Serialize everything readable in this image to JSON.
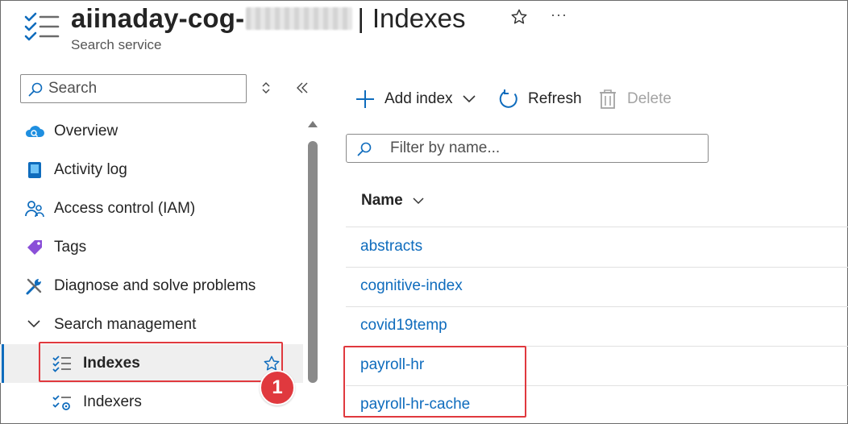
{
  "header": {
    "service_name": "aiinaday-cog-",
    "separator": "|",
    "page_title": "Indexes",
    "subtitle": "Search service",
    "more_label": "···"
  },
  "sidebar": {
    "search_placeholder": "Search",
    "items": [
      {
        "label": "Overview",
        "icon": "cloud-search-icon"
      },
      {
        "label": "Activity log",
        "icon": "activity-log-icon"
      },
      {
        "label": "Access control (IAM)",
        "icon": "people-icon"
      },
      {
        "label": "Tags",
        "icon": "tag-icon"
      },
      {
        "label": "Diagnose and solve problems",
        "icon": "wrench-icon"
      },
      {
        "label": "Search management",
        "icon": "chevron-down-icon"
      },
      {
        "label": "Indexes",
        "icon": "checklist-icon"
      },
      {
        "label": "Indexers",
        "icon": "checklist-gear-icon"
      }
    ],
    "callout_number": "1"
  },
  "toolbar": {
    "add_label": "Add index",
    "refresh_label": "Refresh",
    "delete_label": "Delete"
  },
  "filter": {
    "placeholder": "Filter by name..."
  },
  "table": {
    "column_name": "Name",
    "rows": [
      "abstracts",
      "cognitive-index",
      "covid19temp",
      "payroll-hr",
      "payroll-hr-cache"
    ]
  },
  "colors": {
    "accent": "#0f6cbd",
    "highlight": "#e0393e"
  }
}
